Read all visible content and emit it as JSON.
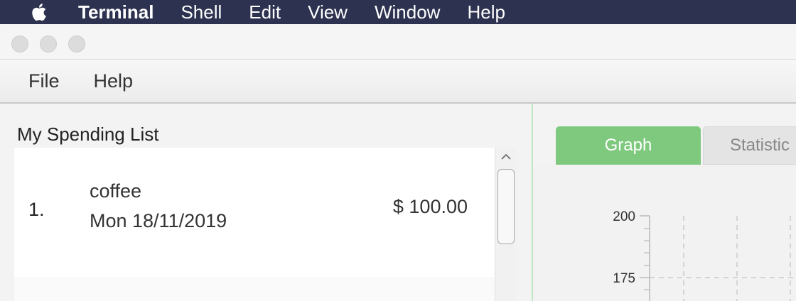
{
  "menubar": {
    "app_name": "Terminal",
    "items": [
      "Shell",
      "Edit",
      "View",
      "Window",
      "Help"
    ]
  },
  "app_menu": {
    "items": [
      "File",
      "Help"
    ]
  },
  "spending_list": {
    "title": "My Spending List",
    "entries": [
      {
        "index": "1.",
        "description": "coffee",
        "date": "Mon 18/11/2019",
        "amount": "$ 100.00"
      }
    ]
  },
  "tabs": {
    "graph": "Graph",
    "statistics": "Statistic"
  },
  "graph": {
    "y_ticks": [
      "200",
      "175"
    ]
  },
  "colors": {
    "menubar_bg": "#2d3250",
    "tab_active": "#7ec97d",
    "divider": "#bfe6c4"
  }
}
